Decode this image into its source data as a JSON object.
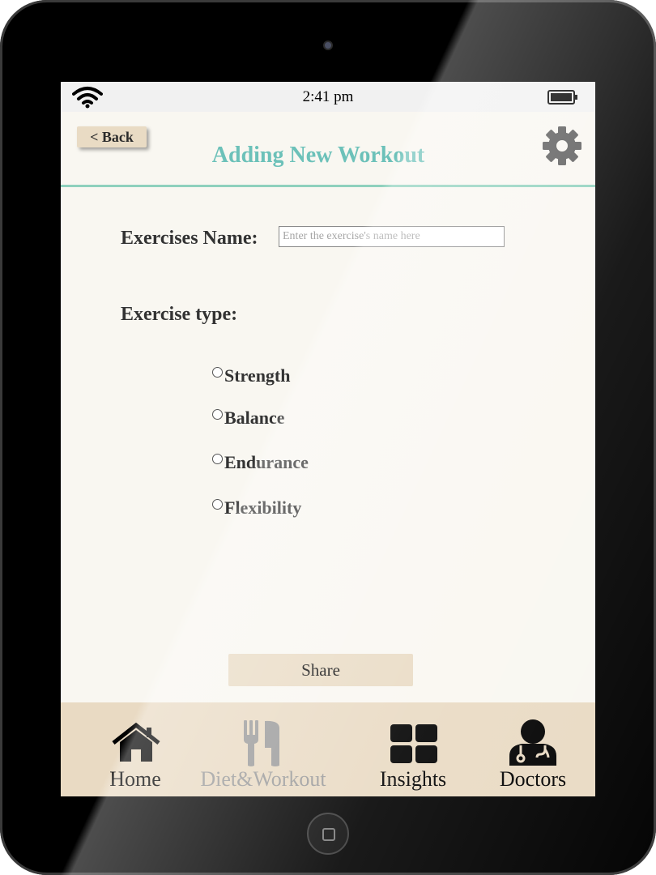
{
  "status_bar": {
    "time": "2:41 pm",
    "wifi_icon": "wifi-icon",
    "battery_icon": "battery-icon"
  },
  "header": {
    "back_label": "< Back",
    "title": "Adding New Workout",
    "settings_icon": "gear-icon"
  },
  "form": {
    "name_label": "Exercises Name:",
    "name_placeholder": "Enter the exercise's name here",
    "name_value": "",
    "type_label": "Exercise type:",
    "options": [
      {
        "label": "Strength",
        "selected": false
      },
      {
        "label": "Balance",
        "selected": false
      },
      {
        "label": "Endurance",
        "selected": false
      },
      {
        "label": "Flexibility",
        "selected": false
      }
    ],
    "share_label": "Share"
  },
  "tabs": [
    {
      "label": "Home",
      "icon": "home-icon",
      "active": true
    },
    {
      "label": "Diet&Workout",
      "icon": "fork-knife-icon",
      "active": false
    },
    {
      "label": "Insights",
      "icon": "grid-icon",
      "active": true
    },
    {
      "label": "Doctors",
      "icon": "doctor-icon",
      "active": true
    }
  ],
  "colors": {
    "title": "#6cc1b9",
    "header_divider": "#8fd1bd",
    "button_bg": "#e9dbc4",
    "tab_bar_bg": "#e9dac3",
    "inactive_tab": "#9a9a9a",
    "screen_bg": "#f9f7f1"
  }
}
